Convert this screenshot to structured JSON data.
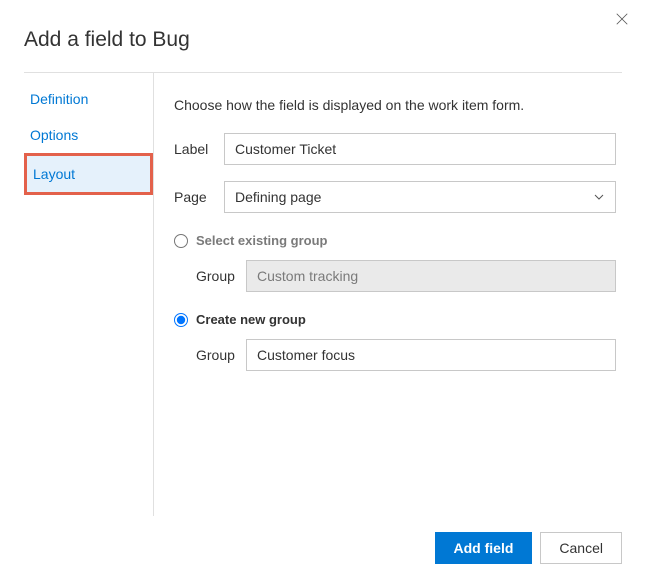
{
  "title": "Add a field to Bug",
  "tabs": {
    "definition": "Definition",
    "options": "Options",
    "layout": "Layout"
  },
  "description": "Choose how the field is displayed on the work item form.",
  "form": {
    "label_caption": "Label",
    "label_value": "Customer Ticket",
    "page_caption": "Page",
    "page_value": "Defining page",
    "select_existing_label": "Select existing group",
    "existing_group_caption": "Group",
    "existing_group_value": "Custom tracking",
    "create_new_label": "Create new group",
    "new_group_caption": "Group",
    "new_group_value": "Customer focus"
  },
  "buttons": {
    "primary": "Add field",
    "cancel": "Cancel"
  }
}
